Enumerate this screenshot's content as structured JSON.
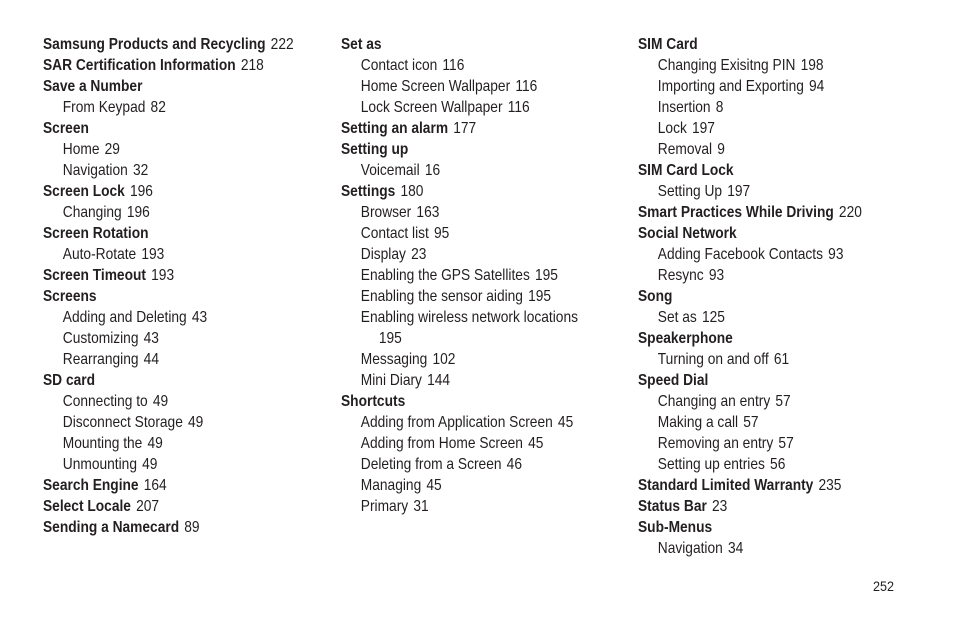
{
  "columns": [
    [
      {
        "term": "Samsung Products and Recycling",
        "page": "222",
        "level": 0
      },
      {
        "term": "SAR Certification Information",
        "page": "218",
        "level": 0
      },
      {
        "term": "Save a Number",
        "page": "",
        "level": 0
      },
      {
        "term": "From Keypad",
        "page": "82",
        "level": 1
      },
      {
        "term": "Screen",
        "page": "",
        "level": 0
      },
      {
        "term": "Home",
        "page": "29",
        "level": 1
      },
      {
        "term": "Navigation",
        "page": "32",
        "level": 1
      },
      {
        "term": "Screen Lock",
        "page": "196",
        "level": 0
      },
      {
        "term": "Changing",
        "page": "196",
        "level": 1
      },
      {
        "term": "Screen Rotation",
        "page": "",
        "level": 0
      },
      {
        "term": "Auto-Rotate",
        "page": "193",
        "level": 1
      },
      {
        "term": "Screen Timeout",
        "page": "193",
        "level": 0
      },
      {
        "term": "Screens",
        "page": "",
        "level": 0
      },
      {
        "term": "Adding and Deleting",
        "page": "43",
        "level": 1
      },
      {
        "term": "Customizing",
        "page": "43",
        "level": 1
      },
      {
        "term": "Rearranging",
        "page": "44",
        "level": 1
      },
      {
        "term": "SD card",
        "page": "",
        "level": 0
      },
      {
        "term": "Connecting to",
        "page": "49",
        "level": 1
      },
      {
        "term": "Disconnect Storage",
        "page": "49",
        "level": 1
      },
      {
        "term": "Mounting the",
        "page": "49",
        "level": 1
      },
      {
        "term": "Unmounting",
        "page": "49",
        "level": 1
      },
      {
        "term": "Search Engine",
        "page": "164",
        "level": 0
      },
      {
        "term": "Select Locale",
        "page": "207",
        "level": 0
      },
      {
        "term": "Sending a Namecard",
        "page": "89",
        "level": 0
      }
    ],
    [
      {
        "term": "Set as",
        "page": "",
        "level": 0
      },
      {
        "term": "Contact icon",
        "page": "116",
        "level": 1
      },
      {
        "term": "Home Screen Wallpaper",
        "page": "116",
        "level": 1
      },
      {
        "term": "Lock Screen Wallpaper",
        "page": "116",
        "level": 1
      },
      {
        "term": "Setting an alarm",
        "page": "177",
        "level": 0
      },
      {
        "term": "Setting up",
        "page": "",
        "level": 0
      },
      {
        "term": "Voicemail",
        "page": "16",
        "level": 1
      },
      {
        "term": "Settings",
        "page": "180",
        "level": 0
      },
      {
        "term": "Browser",
        "page": "163",
        "level": 1
      },
      {
        "term": "Contact list",
        "page": "95",
        "level": 1
      },
      {
        "term": "Display",
        "page": "23",
        "level": 1
      },
      {
        "term": "Enabling the GPS Satellites",
        "page": "195",
        "level": 1
      },
      {
        "term": "Enabling the sensor aiding",
        "page": "195",
        "level": 1
      },
      {
        "term": "Enabling wireless network locations",
        "page": "",
        "level": 1
      },
      {
        "term": "",
        "page": "195",
        "level": 2
      },
      {
        "term": "Messaging",
        "page": "102",
        "level": 1
      },
      {
        "term": "Mini Diary",
        "page": "144",
        "level": 1
      },
      {
        "term": "Shortcuts",
        "page": "",
        "level": 0
      },
      {
        "term": "Adding from Application Screen",
        "page": "45",
        "level": 1
      },
      {
        "term": "Adding from Home Screen",
        "page": "45",
        "level": 1
      },
      {
        "term": "Deleting from a Screen",
        "page": "46",
        "level": 1
      },
      {
        "term": "Managing",
        "page": "45",
        "level": 1
      },
      {
        "term": "Primary",
        "page": "31",
        "level": 1
      }
    ],
    [
      {
        "term": "SIM Card",
        "page": "",
        "level": 0
      },
      {
        "term": "Changing Exisitng PIN",
        "page": "198",
        "level": 1
      },
      {
        "term": "Importing and Exporting",
        "page": "94",
        "level": 1
      },
      {
        "term": "Insertion",
        "page": "8",
        "level": 1
      },
      {
        "term": "Lock",
        "page": "197",
        "level": 1
      },
      {
        "term": "Removal",
        "page": "9",
        "level": 1
      },
      {
        "term": "SIM Card Lock",
        "page": "",
        "level": 0
      },
      {
        "term": "Setting Up",
        "page": "197",
        "level": 1
      },
      {
        "term": "Smart Practices While Driving",
        "page": "220",
        "level": 0
      },
      {
        "term": "Social Network",
        "page": "",
        "level": 0
      },
      {
        "term": "Adding Facebook Contacts",
        "page": "93",
        "level": 1
      },
      {
        "term": "Resync",
        "page": "93",
        "level": 1
      },
      {
        "term": "Song",
        "page": "",
        "level": 0
      },
      {
        "term": "Set as",
        "page": "125",
        "level": 1
      },
      {
        "term": "Speakerphone",
        "page": "",
        "level": 0
      },
      {
        "term": "Turning on and off",
        "page": "61",
        "level": 1
      },
      {
        "term": "Speed Dial",
        "page": "",
        "level": 0
      },
      {
        "term": "Changing an entry",
        "page": "57",
        "level": 1
      },
      {
        "term": "Making a call",
        "page": "57",
        "level": 1
      },
      {
        "term": "Removing an entry",
        "page": "57",
        "level": 1
      },
      {
        "term": "Setting up entries",
        "page": "56",
        "level": 1
      },
      {
        "term": "Standard Limited Warranty",
        "page": "235",
        "level": 0
      },
      {
        "term": "Status Bar",
        "page": "23",
        "level": 0
      },
      {
        "term": "Sub-Menus",
        "page": "",
        "level": 0
      },
      {
        "term": "Navigation",
        "page": "34",
        "level": 1
      }
    ]
  ],
  "footer": {
    "page_number": "252"
  }
}
